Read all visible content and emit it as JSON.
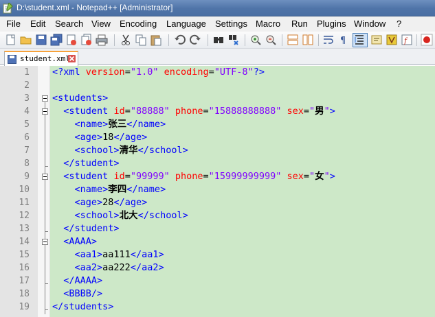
{
  "window": {
    "title": "D:\\student.xml - Notepad++ [Administrator]"
  },
  "menu": [
    "File",
    "Edit",
    "Search",
    "View",
    "Encoding",
    "Language",
    "Settings",
    "Macro",
    "Run",
    "Plugins",
    "Window",
    "?"
  ],
  "toolbar": {
    "buttons": [
      "new-icon",
      "open-icon",
      "save-icon",
      "save-all-icon",
      "close-icon",
      "close-all-icon",
      "print-icon",
      "cut-icon",
      "copy-icon",
      "paste-icon",
      "undo-icon",
      "redo-icon",
      "find-icon",
      "replace-icon",
      "zoom-in-icon",
      "zoom-out-icon",
      "sync-v-icon",
      "sync-h-icon",
      "wrap-icon",
      "show-all-icon",
      "indent-guide-icon",
      "udl-icon",
      "doc-map-icon",
      "function-list-icon",
      "record-macro-icon"
    ]
  },
  "tab": {
    "label": "student.xml"
  },
  "colors": {
    "text_bg": "#cde8c8",
    "tag": "#0000ff",
    "attribute": "#ff0000",
    "value": "#8000ff",
    "tab_accent": "#f7a23b"
  },
  "lines": [
    {
      "n": "1",
      "text": "<?xml version=\"1.0\" encoding=\"UTF-8\"?>"
    },
    {
      "n": "2",
      "text": ""
    },
    {
      "n": "3",
      "text": "<students>"
    },
    {
      "n": "4",
      "text": "  <student id=\"88888\" phone=\"15888888888\" sex=\"男\">"
    },
    {
      "n": "5",
      "text": "    <name>张三</name>"
    },
    {
      "n": "6",
      "text": "    <age>18</age>"
    },
    {
      "n": "7",
      "text": "    <school>清华</school>"
    },
    {
      "n": "8",
      "text": "  </student>"
    },
    {
      "n": "9",
      "text": "  <student id=\"99999\" phone=\"15999999999\" sex=\"女\">"
    },
    {
      "n": "10",
      "text": "    <name>李四</name>"
    },
    {
      "n": "11",
      "text": "    <age>28</age>"
    },
    {
      "n": "12",
      "text": "    <school>北大</school>"
    },
    {
      "n": "13",
      "text": "  </student>"
    },
    {
      "n": "14",
      "text": "  <AAAA>"
    },
    {
      "n": "15",
      "text": "    <aa1>aa111</aa1>"
    },
    {
      "n": "16",
      "text": "    <aa2>aa222</aa2>"
    },
    {
      "n": "17",
      "text": "  </AAAA>"
    },
    {
      "n": "18",
      "text": "  <BBBB/>"
    },
    {
      "n": "19",
      "text": "</students>"
    }
  ]
}
